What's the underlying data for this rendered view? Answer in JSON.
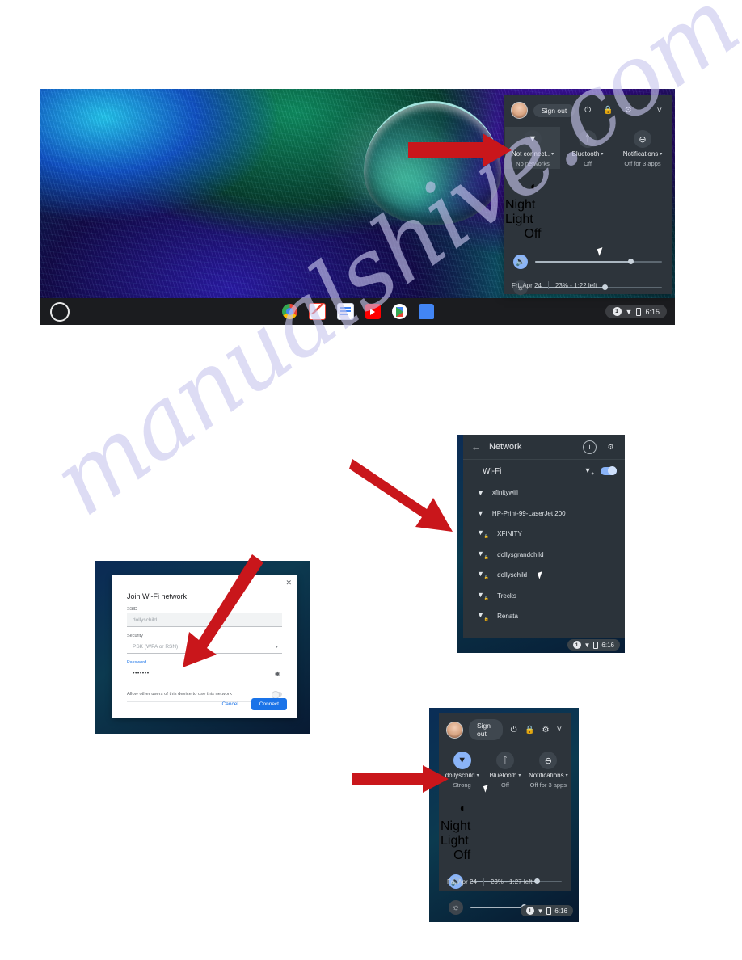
{
  "watermark": {
    "text": "manualshive.com"
  },
  "shot1": {
    "name": "chromebook-desktop-quick-settings",
    "shelf": {
      "launcher_icon": "launcher-circle-icon",
      "apps": [
        {
          "name": "chrome-icon",
          "label": "Chrome"
        },
        {
          "name": "gmail-icon",
          "label": "Gmail"
        },
        {
          "name": "docs-icon",
          "label": "Docs"
        },
        {
          "name": "youtube-icon",
          "label": "YouTube"
        },
        {
          "name": "play-store-icon",
          "label": "Play Store"
        },
        {
          "name": "files-icon",
          "label": "Files"
        }
      ],
      "tray": {
        "notification_count": "1",
        "wifi_icon": "wifi-no-network-icon",
        "battery_icon": "battery-icon",
        "time": "6:15"
      }
    },
    "menu": {
      "sign_out": "Sign out",
      "icons": {
        "power": "power-icon",
        "lock": "lock-icon",
        "settings": "gear-icon",
        "collapse": "chevron-down-icon"
      },
      "tiles": [
        {
          "icon": "wifi-off-icon",
          "title": "Not connect..",
          "subtitle": "No networks",
          "caret": "▾",
          "highlighted": true
        },
        {
          "icon": "bluetooth-icon",
          "title": "Bluetooth",
          "subtitle": "Off",
          "caret": "▾",
          "highlighted": false
        },
        {
          "icon": "do-not-disturb-icon",
          "title": "Notifications",
          "subtitle": "Off for 3 apps",
          "caret": "▾",
          "highlighted": false
        }
      ],
      "night_light": {
        "icon": "night-light-icon",
        "title": "Night Light",
        "subtitle": "Off"
      },
      "volume": {
        "icon": "volume-icon",
        "value": 75
      },
      "brightness": {
        "icon": "brightness-icon",
        "value": 55
      },
      "footer": {
        "date": "Fri, Apr 24",
        "battery": "23% - 1:22 left"
      }
    }
  },
  "shot2": {
    "name": "network-detail-panel",
    "header": {
      "back_icon": "back-arrow-icon",
      "title": "Network",
      "info_icon": "info-icon",
      "settings_icon": "gear-icon"
    },
    "wifi_row": {
      "label": "Wi-Fi",
      "add_icon": "add-network-icon",
      "toggle_on": true
    },
    "networks": [
      {
        "name": "xfinitywifi",
        "icon": "wifi-open-icon"
      },
      {
        "name": "HP-Print-99-LaserJet 200",
        "icon": "wifi-open-icon"
      },
      {
        "name": "XFINITY",
        "icon": "wifi-secure-icon"
      },
      {
        "name": "dollysgrandchild",
        "icon": "wifi-secure-icon"
      },
      {
        "name": "dollyschild",
        "icon": "wifi-secure-icon"
      },
      {
        "name": "Trecks",
        "icon": "wifi-secure-icon"
      },
      {
        "name": "Renata",
        "icon": "wifi-secure-icon"
      }
    ],
    "tray": {
      "notification_count": "1",
      "time": "6:16"
    }
  },
  "shot3": {
    "name": "join-wifi-dialog",
    "close_icon": "close-icon",
    "title": "Join Wi-Fi network",
    "ssid": {
      "label": "SSID",
      "value": "dollyschild"
    },
    "security": {
      "label": "Security",
      "value": "PSK (WPA or RSN)",
      "caret": "▾"
    },
    "password": {
      "label": "Password",
      "value": "•••••••",
      "reveal_icon": "eye-icon"
    },
    "allow_others": {
      "label": "Allow other users of this device to use this network",
      "toggle_on": false
    },
    "buttons": {
      "cancel": "Cancel",
      "connect": "Connect"
    }
  },
  "shot4": {
    "name": "quick-settings-connected",
    "menu": {
      "sign_out": "Sign out",
      "icons": {
        "power": "power-icon",
        "lock": "lock-icon",
        "settings": "gear-icon",
        "collapse": "chevron-down-icon"
      },
      "tiles": [
        {
          "icon": "wifi-connected-icon",
          "title": "dollyschild",
          "subtitle": "Strong",
          "caret": "▾",
          "highlighted": false
        },
        {
          "icon": "bluetooth-icon",
          "title": "Bluetooth",
          "subtitle": "Off",
          "caret": "▾",
          "highlighted": false
        },
        {
          "icon": "do-not-disturb-icon",
          "title": "Notifications",
          "subtitle": "Off for 3 apps",
          "caret": "▾",
          "highlighted": false
        }
      ],
      "night_light": {
        "icon": "night-light-icon",
        "title": "Night Light",
        "subtitle": "Off"
      },
      "volume": {
        "icon": "volume-icon",
        "value": 73
      },
      "brightness": {
        "icon": "brightness-icon",
        "value": 58
      },
      "footer": {
        "date": "Fri, Apr 24",
        "battery": "23% - 1:27 left"
      }
    },
    "tray": {
      "notification_count": "1",
      "time": "6:16"
    }
  },
  "annotations": {
    "arrow_color": "#c9161b",
    "arrows": [
      {
        "name": "arrow-to-network-tile"
      },
      {
        "name": "arrow-to-network-list"
      },
      {
        "name": "arrow-to-password-field"
      },
      {
        "name": "arrow-to-connected-tile"
      }
    ]
  }
}
